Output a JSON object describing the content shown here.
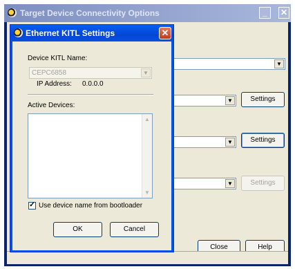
{
  "bg_window": {
    "title": "Target Device Connectivity Options",
    "buttons": {
      "settings_1": "Settings",
      "settings_2": "Settings",
      "settings_3": "Settings",
      "close": "Close",
      "help": "Help"
    },
    "icons": {
      "app": "app-icon",
      "minimize": "minimize-icon",
      "maximize": "maximize-icon",
      "close": "close-icon"
    }
  },
  "dialog": {
    "title": "Ethernet KITL Settings",
    "device_name_label": "Device KITL Name:",
    "device_name_value": "CEPC6858",
    "ip_label": "IP Address:",
    "ip_value": "0.0.0.0",
    "active_devices_label": "Active Devices:",
    "active_devices": [],
    "use_bootloader_label": "Use device name from bootloader",
    "use_bootloader_checked": true,
    "ok_label": "OK",
    "cancel_label": "Cancel"
  },
  "colors": {
    "dialog_title_blue": "#0346d6",
    "face": "#ece9d8",
    "close_red": "#c1391d"
  }
}
